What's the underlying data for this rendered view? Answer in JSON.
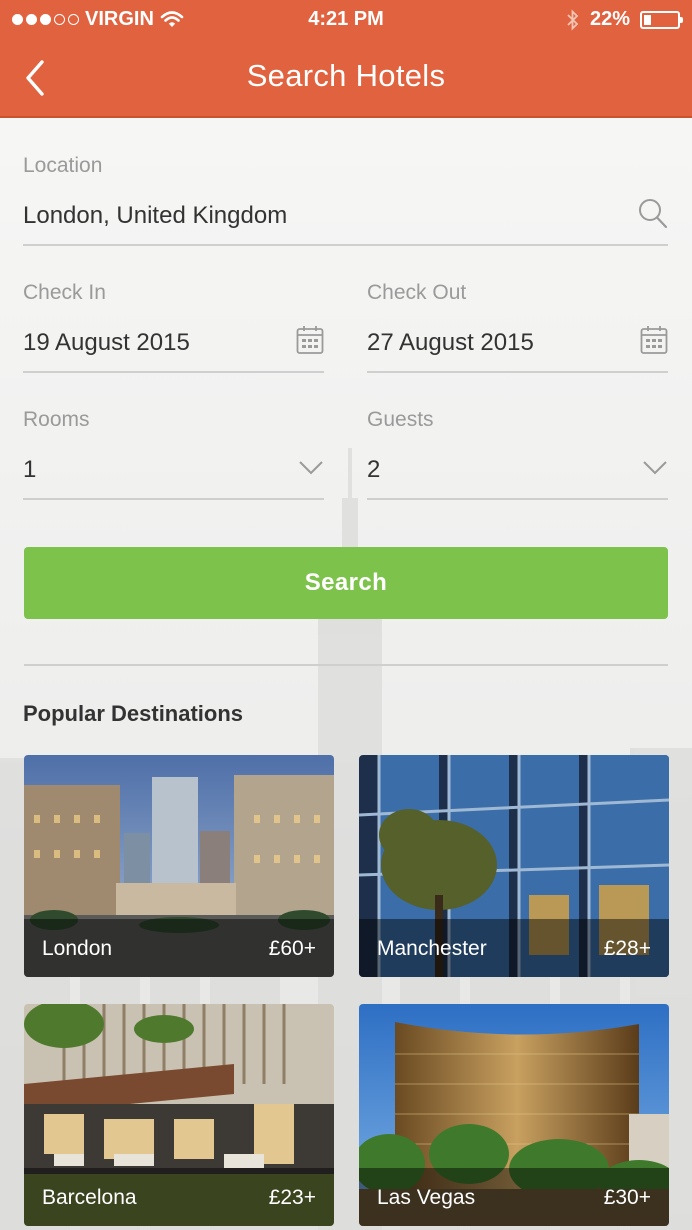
{
  "status_bar": {
    "carrier": "VIRGIN",
    "time": "4:21 PM",
    "battery": "22%",
    "battery_level": 0.22,
    "signal_bars_filled": 3,
    "signal_bars_total": 5
  },
  "header": {
    "title": "Search Hotels",
    "back_icon": "chevron-left-icon",
    "background_color": "#e0623f"
  },
  "form": {
    "location": {
      "label": "Location",
      "value": "London, United Kingdom",
      "icon": "search-icon"
    },
    "check_in": {
      "label": "Check In",
      "value": "19 August 2015",
      "icon": "calendar-icon"
    },
    "check_out": {
      "label": "Check Out",
      "value": "27 August 2015",
      "icon": "calendar-icon"
    },
    "rooms": {
      "label": "Rooms",
      "value": "1",
      "icon": "chevron-down-icon"
    },
    "guests": {
      "label": "Guests",
      "value": "2",
      "icon": "chevron-down-icon"
    },
    "search_button": {
      "label": "Search",
      "color": "#7dc24a"
    }
  },
  "popular": {
    "title": "Popular Destinations",
    "destinations": [
      {
        "name": "London",
        "price": "£60+"
      },
      {
        "name": "Manchester",
        "price": "£28+"
      },
      {
        "name": "Barcelona",
        "price": "£23+"
      },
      {
        "name": "Las Vegas",
        "price": "£30+"
      }
    ]
  }
}
